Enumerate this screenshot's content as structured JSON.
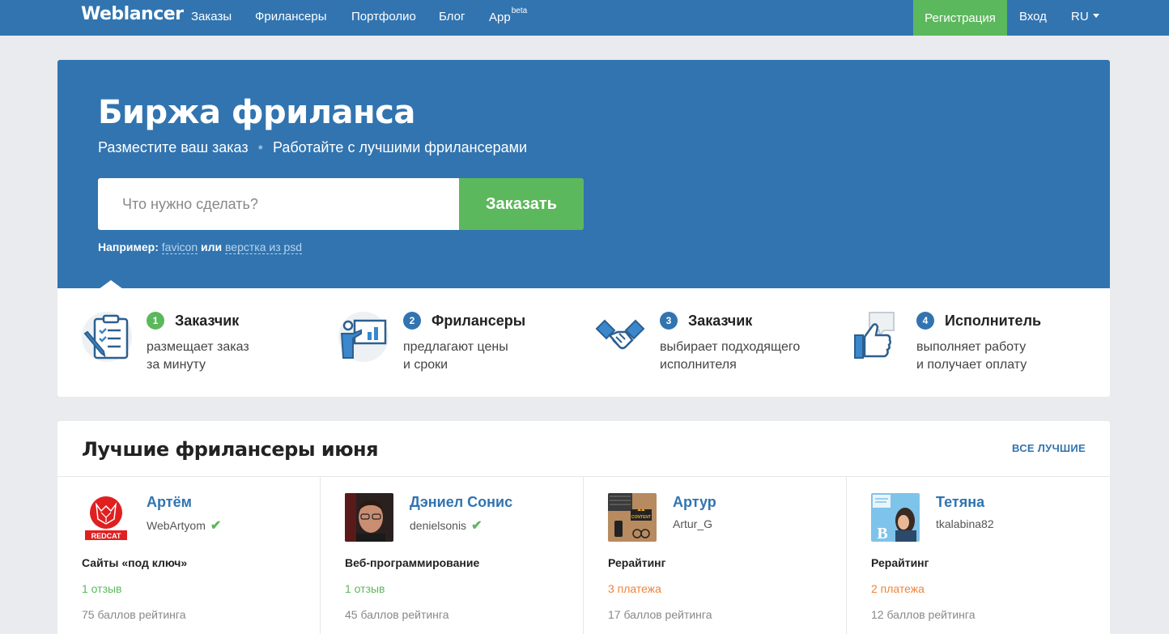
{
  "nav": {
    "logo": "Weblancer",
    "links": [
      "Заказы",
      "Фрилансеры",
      "Портфолио",
      "Блог",
      "App"
    ],
    "app_sup": "beta",
    "register": "Регистрация",
    "login": "Вход",
    "lang": "RU"
  },
  "hero": {
    "title": "Биржа фриланса",
    "sub1": "Разместите ваш заказ",
    "sub_sep": "•",
    "sub2": "Работайте с лучшими фрилансерами",
    "search_placeholder": "Что нужно сделать?",
    "order_button": "Заказать",
    "example_label": "Например:",
    "example_link1": "favicon",
    "example_or": "или",
    "example_link2": "верстка из psd"
  },
  "steps": [
    {
      "num": "1",
      "title": "Заказчик",
      "line1": "размещает заказ",
      "line2": "за минуту",
      "num_color": "#5cb85c",
      "icon": "clipboard-icon"
    },
    {
      "num": "2",
      "title": "Фрилансеры",
      "line1": "предлагают цены",
      "line2": "и сроки",
      "num_color": "#3174b0",
      "icon": "presentation-icon"
    },
    {
      "num": "3",
      "title": "Заказчик",
      "line1": "выбирает подходящего",
      "line2": "исполнителя",
      "num_color": "#3174b0",
      "icon": "handshake-icon"
    },
    {
      "num": "4",
      "title": "Исполнитель",
      "line1": "выполняет работу",
      "line2": "и получает оплату",
      "num_color": "#3174b0",
      "icon": "thumbs-up-icon"
    }
  ],
  "best": {
    "title": "Лучшие фрилансеры июня",
    "all_link": "ВСЕ ЛУЧШИЕ",
    "freelancers": [
      {
        "name": "Артём",
        "login": "WebArtyom",
        "verified": true,
        "spec": "Сайты «под ключ»",
        "stat": "1 отзыв",
        "rating": "75 баллов рейтинга",
        "avatar_text": "REDCAT"
      },
      {
        "name": "Дэниел Сонис",
        "login": "denielsonis",
        "verified": true,
        "spec": "Веб-программирование",
        "stat": "1 отзыв",
        "rating": "45 баллов рейтинга"
      },
      {
        "name": "Артур",
        "login": "Artur_G",
        "verified": false,
        "spec": "Рерайтинг",
        "stat": "3 платежа",
        "rating": "17 баллов рейтинга",
        "avatar_text": "CONTENT"
      },
      {
        "name": "Тетяна",
        "login": "tkalabina82",
        "verified": false,
        "spec": "Рерайтинг",
        "stat": "2 платежа",
        "rating": "12 баллов рейтинга",
        "avatar_text": "B"
      }
    ]
  },
  "colors": {
    "brand_blue": "#3174b0",
    "green": "#5cb85c",
    "orange": "#f0833a"
  }
}
